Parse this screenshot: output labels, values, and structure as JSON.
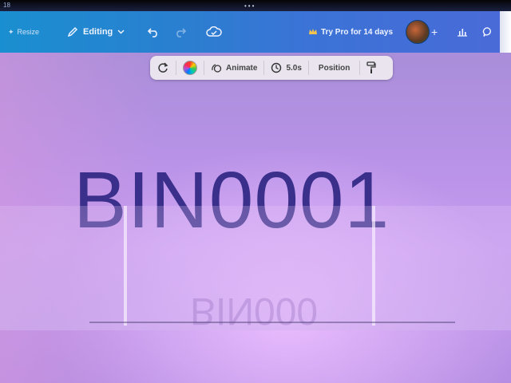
{
  "status": {
    "time_fragment": "18"
  },
  "toolbar": {
    "resize_label": "Resize",
    "editing_label": "Editing",
    "try_pro_label": "Try Pro for 14 days",
    "plus_label": "+"
  },
  "context_bar": {
    "animate_label": "Animate",
    "duration_label": "5.0s",
    "position_label": "Position"
  },
  "canvas": {
    "main_text": "BIN0001",
    "reflection_text": "BIN000"
  },
  "colors": {
    "toolbar_start": "#1a8fd0",
    "toolbar_end": "#4a6ad8",
    "canvas_bg": "#b792e6",
    "text_color": "#3a2f8a"
  },
  "icons": [
    "resize-icon",
    "pencil-icon",
    "chevron-down-icon",
    "undo-icon",
    "redo-icon",
    "cloud-sync-icon",
    "crown-icon",
    "avatar",
    "plus-icon",
    "stats-icon",
    "comment-icon",
    "replace-icon",
    "color-wheel-icon",
    "animate-icon",
    "clock-icon",
    "paint-roller-icon"
  ]
}
